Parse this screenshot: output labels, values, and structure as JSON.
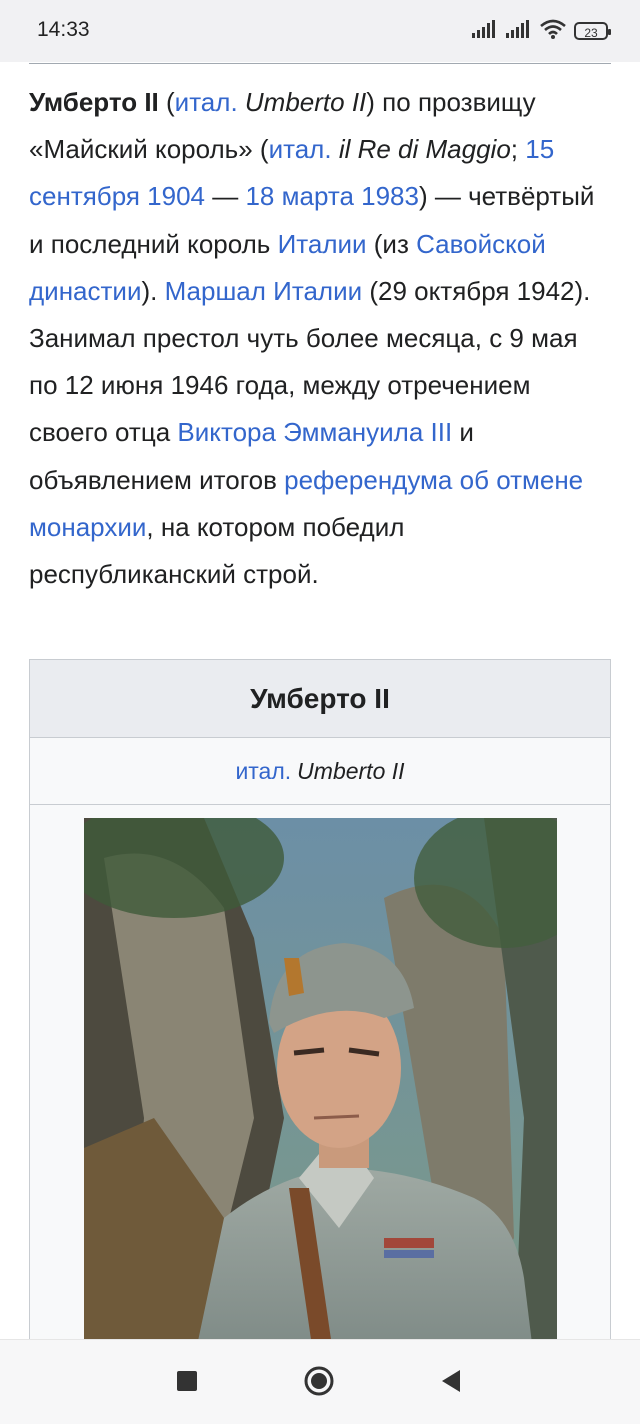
{
  "status_bar": {
    "time": "14:33",
    "battery": "23",
    "icons": [
      "signal-icon",
      "signal-icon",
      "wifi-icon",
      "battery-icon"
    ]
  },
  "article": {
    "lead": {
      "name": "Умберто II",
      "lang1": "итал.",
      "orig_name": "Umberto II",
      "t1": " по прозвищу «Майский король» (",
      "lang2": "итал.",
      "nickname": "il Re di Maggio",
      "t2": ";",
      "birth": "15 сентября 1904",
      "dash": " — ",
      "death": "18 марта 1983",
      "t3": ") — четвёртый и последний король ",
      "italy": "Италии",
      "t4": " (из ",
      "dynasty": "Савойской династии",
      "t5": "). ",
      "marshal": "Маршал Италии",
      "t6": " (29 октября 1942). Занимал престол чуть более месяца, с 9 мая по 12 июня 1946 года, между отречением своего отца ",
      "father": "Виктора Эммануила III",
      "t7": " и объявлением итогов ",
      "referendum": "референдума об отмене монархии",
      "t8": ", на котором победил республиканский строй."
    }
  },
  "infobox": {
    "title": "Умберто II",
    "lang": "итал.",
    "orig_name": "Umberto II"
  },
  "nav": {
    "buttons": [
      "recents-button",
      "home-button",
      "back-button"
    ]
  },
  "colors": {
    "link": "#3366cc",
    "text": "#202122",
    "infobox_header": "#eaecf0"
  }
}
